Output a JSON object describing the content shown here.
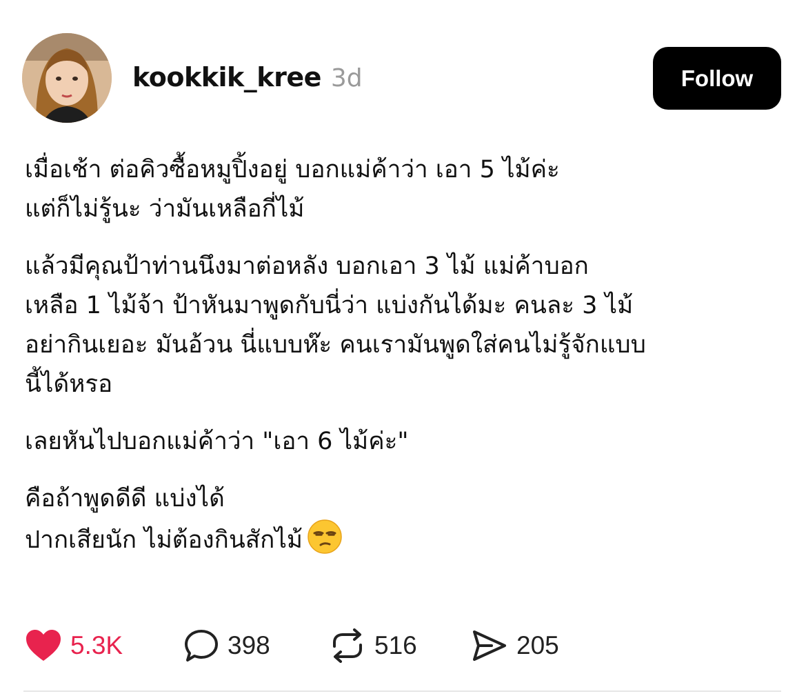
{
  "post": {
    "username": "kookkik_kree",
    "time": "3d",
    "follow_label": "Follow",
    "paragraphs": [
      [
        "เมื่อเช้า ต่อคิวซื้อหมูปิ้งอยู่ บอกแม่ค้าว่า เอา 5 ไม้ค่ะ",
        "แต่ก็ไม่รู้นะ ว่ามันเหลือกี่ไม้"
      ],
      [
        "แล้วมีคุณป้าท่านนึงมาต่อหลัง บอกเอา 3 ไม้ แม่ค้าบอก",
        "เหลือ 1 ไม้จ้า ป้าหันมาพูดกับนี่ว่า แบ่งกันได้มะ คนละ 3 ไม้",
        "อย่ากินเยอะ มันอ้วน นี่แบบห๊ะ คนเรามันพูดใส่คนไม่รู้จักแบบ",
        "นี้ได้หรอ"
      ],
      [
        "เลยหันไปบอกแม่ค้าว่า \"เอา 6 ไม้ค่ะ\""
      ],
      [
        "คือถ้าพูดดีดี แบ่งได้",
        "ปากเสียนัก ไม่ต้องกินสักไม้"
      ]
    ],
    "emoji": "unamused-face-emoji"
  },
  "actions": {
    "likes": "5.3K",
    "comments": "398",
    "reposts": "516",
    "shares": "205"
  },
  "colors": {
    "like": "#e8234e",
    "follow_bg": "#000000",
    "time": "#9a9a9a"
  },
  "icons": [
    "heart-icon",
    "comment-icon",
    "repost-icon",
    "send-icon"
  ]
}
